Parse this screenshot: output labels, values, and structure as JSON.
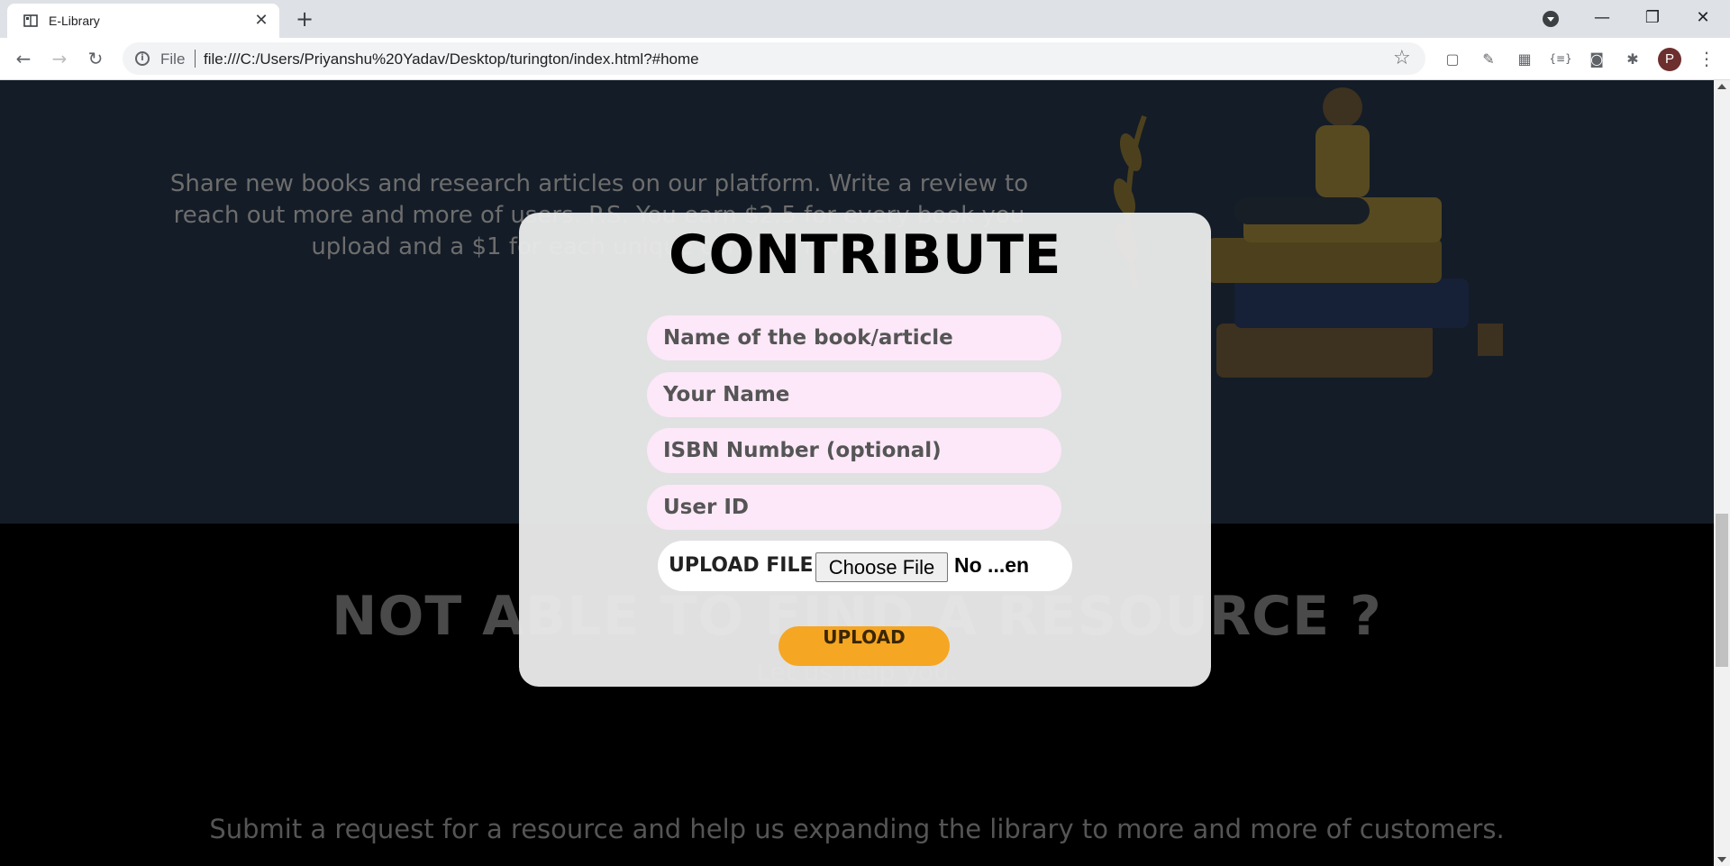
{
  "browser": {
    "tab_title": "E-Library",
    "new_tab": "+",
    "scheme": "File",
    "url": "file:///C:/Users/Priyanshu%20Yadav/Desktop/turington/index.html?#home",
    "profile_initial": "P",
    "window_controls": [
      "minimize-icon",
      "restore-icon",
      "close-icon"
    ]
  },
  "page": {
    "share_text": "Share new books and research articles on our platform. Write a review to reach out more and more of users. P.S. You earn $2.5 for every book you upload and a $1 for each unique certified review.",
    "headline": "NOT ABLE TO FIND A RESOURCE ?",
    "subline": "Let us help you.",
    "submit_text": "Submit a request for a resource and help us expanding the library to more and more of customers."
  },
  "modal": {
    "title": "CONTRIBUTE",
    "fields": {
      "book_name": "Name of the book/article",
      "your_name": "Your Name",
      "isbn": "ISBN Number (optional)",
      "user_id": "User ID"
    },
    "upload_label": "UPLOAD FILE",
    "choose_file": "Choose File",
    "no_file": "No ...en",
    "upload_button": "UPLOAD"
  },
  "colors": {
    "accent": "#f5a623",
    "field_bg": "#fce8f8",
    "modal_bg": "#e9e9e9",
    "page_top_bg": "#141c27"
  }
}
